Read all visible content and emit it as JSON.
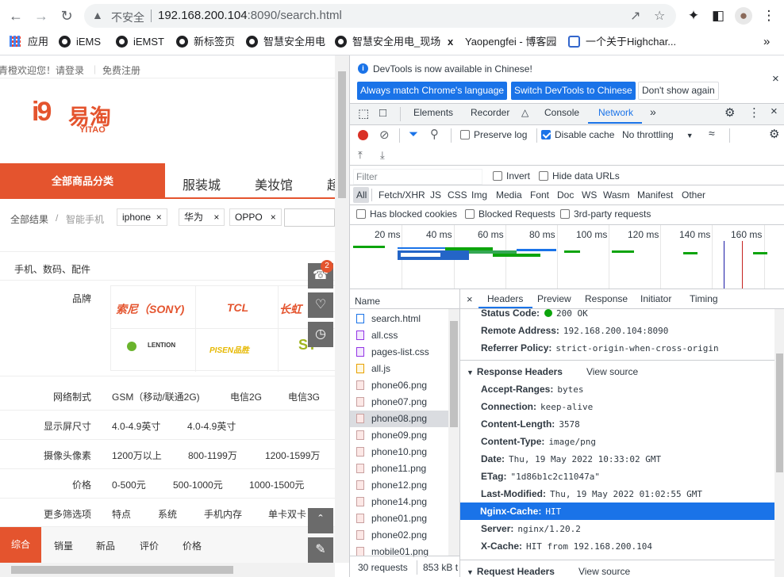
{
  "browser": {
    "security_label": "不安全",
    "url_host": "192.168.200.104",
    "url_rest": ":8090/search.html",
    "bookmarks": [
      "应用",
      "iEMS",
      "iEMST",
      "新标签页",
      "智慧安全用电",
      "智慧安全用电_现场",
      "Yaopengfei - 博客园",
      "一个关于Highchar..."
    ],
    "more_bookmarks": "»"
  },
  "page": {
    "welcome": "青橙欢迎您！请登录",
    "register": "免费注册",
    "logo_cn": "易淘",
    "logo_en": "YITAO",
    "logo_mark": "i9",
    "cat_main": "全部商品分类",
    "cat_items": [
      "服装城",
      "美妆馆",
      "超"
    ],
    "breadcrumb_all": "全部结果",
    "breadcrumb_sep": "/",
    "breadcrumb_cat": "智能手机",
    "tags": [
      "iphone",
      "华为",
      "OPPO"
    ],
    "tag_close": "×",
    "filter_title": "手机、数码、配件",
    "brand_label": "品牌",
    "brands": [
      "索尼（SONY)",
      "TCL",
      "长虹",
      "LENTION",
      "PISEN品胜",
      "ST"
    ],
    "filters": [
      {
        "label": "网络制式",
        "values": [
          "GSM（移动/联通2G)",
          "电信2G",
          "电信3G"
        ]
      },
      {
        "label": "显示屏尺寸",
        "values": [
          "4.0-4.9英寸",
          "4.0-4.9英寸"
        ]
      },
      {
        "label": "摄像头像素",
        "values": [
          "1200万以上",
          "800-1199万",
          "1200-1599万"
        ]
      },
      {
        "label": "价格",
        "values": [
          "0-500元",
          "500-1000元",
          "1000-1500元"
        ]
      },
      {
        "label": "更多筛选项",
        "values": [
          "特点",
          "系统",
          "手机内存",
          "单卡双卡"
        ]
      }
    ],
    "sort_tabs": [
      "综合",
      "销量",
      "新品",
      "评价",
      "价格"
    ],
    "cart_badge": "2"
  },
  "devtools": {
    "notice": "DevTools is now available in Chinese!",
    "btn_match": "Always match Chrome's language",
    "btn_switch": "Switch DevTools to Chinese",
    "btn_dont": "Don't show again",
    "close": "×",
    "tabs": [
      "Elements",
      "Recorder",
      "Console",
      "Network"
    ],
    "more_tabs": "»",
    "preserve_log": "Preserve log",
    "disable_cache": "Disable cache",
    "throttling": "No throttling",
    "filter_placeholder": "Filter",
    "invert": "Invert",
    "hide_data_urls": "Hide data URLs",
    "type_filters": [
      "All",
      "Fetch/XHR",
      "JS",
      "CSS",
      "Img",
      "Media",
      "Font",
      "Doc",
      "WS",
      "Wasm",
      "Manifest",
      "Other"
    ],
    "blocked_cookies": "Has blocked cookies",
    "blocked_requests": "Blocked Requests",
    "third_party": "3rd-party requests",
    "timeline_ticks": [
      "20 ms",
      "40 ms",
      "60 ms",
      "80 ms",
      "100 ms",
      "120 ms",
      "140 ms",
      "160 ms"
    ],
    "name_header": "Name",
    "files": [
      "search.html",
      "all.css",
      "pages-list.css",
      "all.js",
      "phone06.png",
      "phone07.png",
      "phone08.png",
      "phone09.png",
      "phone10.png",
      "phone11.png",
      "phone12.png",
      "phone14.png",
      "phone01.png",
      "phone02.png",
      "mobile01.png"
    ],
    "selected_file_index": 6,
    "summary_requests": "30 requests",
    "summary_size": "853 kB t",
    "detail_tabs": [
      "Headers",
      "Preview",
      "Response",
      "Initiator",
      "Timing"
    ],
    "general": [
      {
        "name": "Status Code:",
        "value": "200 OK"
      },
      {
        "name": "Remote Address:",
        "value": "192.168.200.104:8090"
      },
      {
        "name": "Referrer Policy:",
        "value": "strict-origin-when-cross-origin"
      }
    ],
    "response_headers_title": "Response Headers",
    "view_source": "View source",
    "response_headers": [
      {
        "name": "Accept-Ranges:",
        "value": "bytes"
      },
      {
        "name": "Connection:",
        "value": "keep-alive"
      },
      {
        "name": "Content-Length:",
        "value": "3578"
      },
      {
        "name": "Content-Type:",
        "value": "image/png"
      },
      {
        "name": "Date:",
        "value": "Thu, 19 May 2022 10:33:02 GMT"
      },
      {
        "name": "ETag:",
        "value": "\"1d86b1c2c11047a\""
      },
      {
        "name": "Last-Modified:",
        "value": "Thu, 19 May 2022 01:02:55 GMT"
      },
      {
        "name": "Nginx-Cache:",
        "value": "HIT"
      },
      {
        "name": "Server:",
        "value": "nginx/1.20.2"
      },
      {
        "name": "X-Cache:",
        "value": "HIT from 192.168.200.104"
      }
    ],
    "selected_header_index": 7,
    "request_headers_title": "Request Headers"
  },
  "colors": {
    "brand": "#e4542e",
    "devtools_blue": "#1a73e8",
    "status_green": "#0ca40c"
  }
}
